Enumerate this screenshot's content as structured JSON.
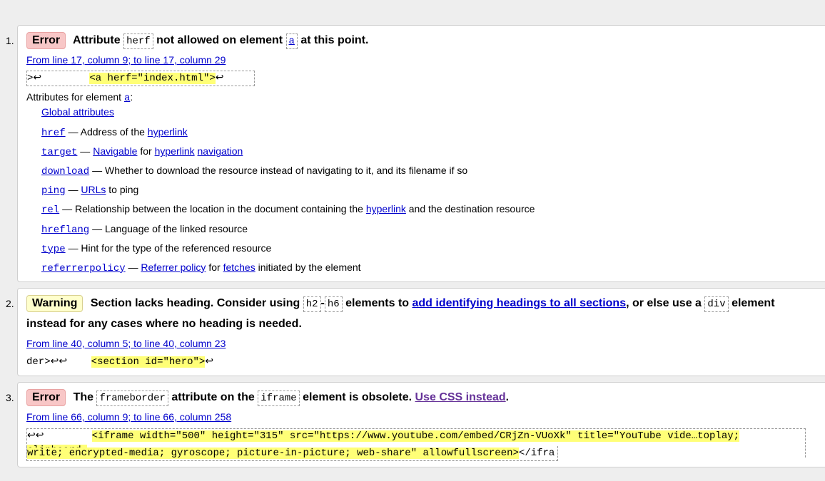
{
  "messages": [
    {
      "number": "1.",
      "type": "Error",
      "msg_parts": [
        "Attribute",
        "herf",
        "not allowed on element",
        "a",
        "at this point."
      ],
      "location": "From line 17, column 9; to line 17, column 29",
      "extract_pre": ">↩        ",
      "extract_hl": "<a herf=\"index.html\">",
      "extract_post": "↩",
      "attrs_intro": "Attributes for element",
      "attrs_intro_el": "a",
      "attrs_intro_colon": ":",
      "global_attrs": "Global attributes",
      "attributes": [
        {
          "name": "href",
          "desc": [
            {
              "t": " — Address of the "
            },
            {
              "l": "hyperlink"
            }
          ]
        },
        {
          "name": "target",
          "desc": [
            {
              "t": " — "
            },
            {
              "l": "Navigable"
            },
            {
              "t": " for "
            },
            {
              "l": "hyperlink"
            },
            {
              "t": " "
            },
            {
              "l": "navigation"
            }
          ]
        },
        {
          "name": "download",
          "desc": [
            {
              "t": " — Whether to download the resource instead of navigating to it, and its filename if so"
            }
          ]
        },
        {
          "name": "ping",
          "desc": [
            {
              "t": " — "
            },
            {
              "l": "URLs"
            },
            {
              "t": " to ping"
            }
          ]
        },
        {
          "name": "rel",
          "desc": [
            {
              "t": " — Relationship between the location in the document containing the "
            },
            {
              "l": "hyperlink"
            },
            {
              "t": " and the destination resource"
            }
          ]
        },
        {
          "name": "hreflang",
          "desc": [
            {
              "t": " — Language of the linked resource"
            }
          ]
        },
        {
          "name": "type",
          "desc": [
            {
              "t": " — Hint for the type of the referenced resource"
            }
          ]
        },
        {
          "name": "referrerpolicy",
          "desc": [
            {
              "t": " — "
            },
            {
              "l": "Referrer policy"
            },
            {
              "t": " for "
            },
            {
              "l": "fetches"
            },
            {
              "t": " initiated by the element"
            }
          ]
        }
      ]
    },
    {
      "number": "2.",
      "type": "Warning",
      "line1": [
        "Section lacks heading. Consider using",
        "h2",
        "-",
        "h6",
        "elements to",
        "add identifying headings to all sections",
        ", or else use a",
        "div",
        "element"
      ],
      "line2": "instead for any cases where no heading is needed.",
      "location": "From line 40, column 5; to line 40, column 23",
      "extract_pre": "der>↩↩    ",
      "extract_hl": "<section id=\"hero\">",
      "extract_post": "↩"
    },
    {
      "number": "3.",
      "type": "Error",
      "msg_parts": [
        "The",
        "frameborder",
        "attribute on the",
        "iframe",
        "element is obsolete.",
        "Use CSS instead",
        "."
      ],
      "location": "From line 66, column 9; to line 66, column 258",
      "extract_pre": "↩↩        ",
      "extract_hl1": "<iframe width=\"500\" height=\"315\" src=\"https://www.youtube.com/embed/CRjZn-VUoXk\" title=\"YouTube vide…toplay; clipboard-",
      "extract_hl2": "write; encrypted-media; gyroscope; picture-in-picture; web-share\" allowfullscreen>",
      "extract_post": "</ifra"
    }
  ]
}
